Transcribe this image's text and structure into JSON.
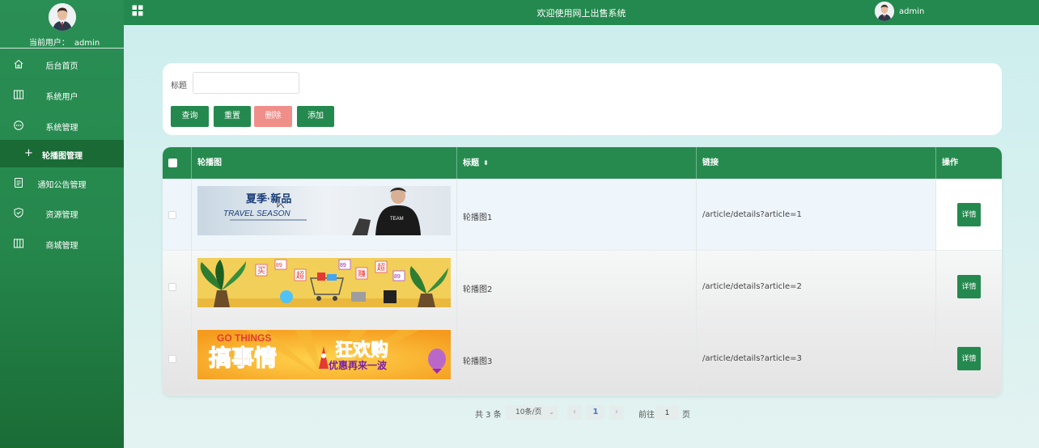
{
  "sidebar": {
    "current_user_label": "当前用户：",
    "current_user": "admin",
    "items": [
      {
        "label": "后台首页",
        "icon": "home-icon"
      },
      {
        "label": "系统用户",
        "icon": "columns-icon"
      },
      {
        "label": "系统管理",
        "icon": "chat-icon"
      },
      {
        "label": "轮播图管理",
        "icon": "plus-icon"
      },
      {
        "label": "通知公告管理",
        "icon": "document-icon"
      },
      {
        "label": "资源管理",
        "icon": "shield-icon"
      },
      {
        "label": "商城管理",
        "icon": "columns-icon"
      }
    ]
  },
  "header": {
    "title": "欢迎使用网上出售系统",
    "user": "admin"
  },
  "search": {
    "label": "标题",
    "placeholder": "",
    "buttons": {
      "query": "查询",
      "reset": "重置",
      "delete": "删除",
      "add": "添加"
    }
  },
  "table": {
    "headers": {
      "image": "轮播图",
      "title": "标题",
      "link": "链接",
      "op": "操作"
    },
    "rows": [
      {
        "title": "轮播图1",
        "link": "/article/details?article=1",
        "detail": "详情"
      },
      {
        "title": "轮播图2",
        "link": "/article/details?article=2",
        "detail": "详情"
      },
      {
        "title": "轮播图3",
        "link": "/article/details?article=3",
        "detail": "详情"
      }
    ],
    "banners": {
      "b1_main": "夏季·新品",
      "b1_sub": "TRAVEL SEASON",
      "b2_words": [
        "买",
        "89",
        "超",
        "89",
        "赚",
        "超",
        "89"
      ],
      "b3_top": "GO THINGS",
      "b3_main": "搞事情",
      "b3_right": "狂欢购",
      "b3_sub": "优惠再来一波"
    }
  },
  "pagination": {
    "total": "共 3 条",
    "page_size": "10条/页",
    "prev": "‹",
    "current": "1",
    "next": "›",
    "goto": "前往",
    "goto_value": "1",
    "page_suffix": "页"
  },
  "colors": {
    "primary": "#24894e",
    "danger": "#f08e8a",
    "background": "#cdeeee"
  }
}
